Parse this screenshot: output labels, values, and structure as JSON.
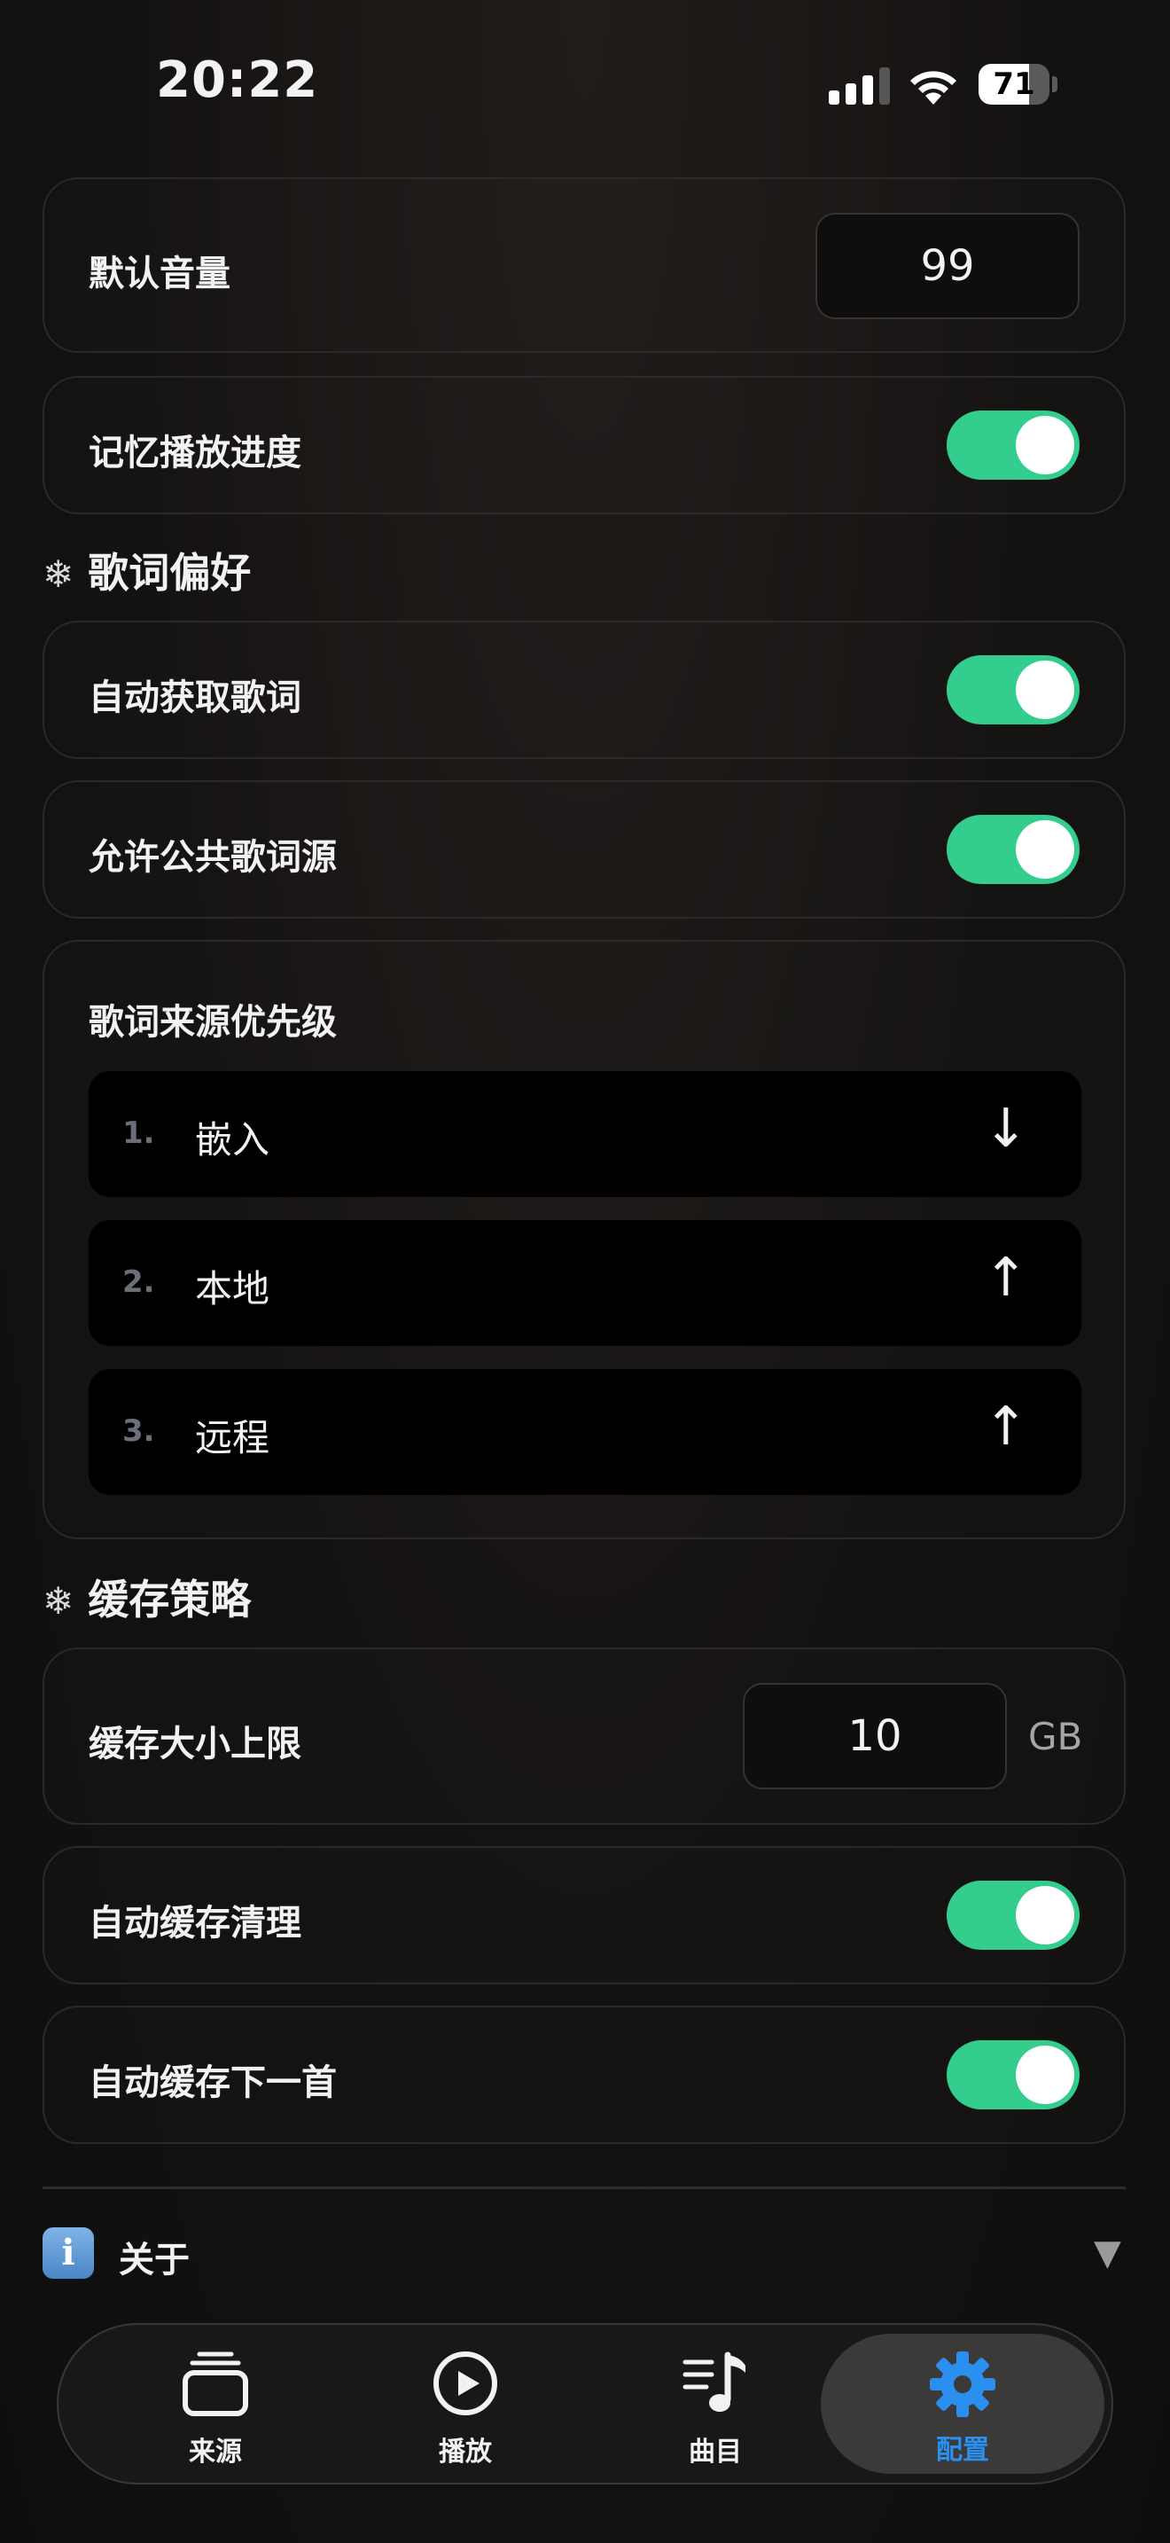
{
  "status_bar": {
    "time": "20:22",
    "battery": "71",
    "battery_level": 0.71
  },
  "playback": {
    "default_volume_label": "默认音量",
    "default_volume_value": "99",
    "remember_progress_label": "记忆播放进度",
    "remember_progress_on": true
  },
  "lyrics": {
    "section_title": "歌词偏好",
    "auto_fetch_label": "自动获取歌词",
    "auto_fetch_on": true,
    "public_source_label": "允许公共歌词源",
    "public_source_on": true,
    "priority_title": "歌词来源优先级",
    "priority": [
      {
        "num": "1.",
        "label": "嵌入",
        "arrow": "↓"
      },
      {
        "num": "2.",
        "label": "本地",
        "arrow": "↑"
      },
      {
        "num": "3.",
        "label": "远程",
        "arrow": "↑"
      }
    ]
  },
  "cache": {
    "section_title": "缓存策略",
    "size_limit_label": "缓存大小上限",
    "size_limit_value": "10",
    "size_unit": "GB",
    "auto_clean_label": "自动缓存清理",
    "auto_clean_on": true,
    "auto_next_label": "自动缓存下一首",
    "auto_next_on": true
  },
  "about": {
    "label": "关于",
    "icon_text": "i",
    "chevron": "▼"
  },
  "tabbar": {
    "items": [
      {
        "label": "来源",
        "icon": "stack-icon"
      },
      {
        "label": "播放",
        "icon": "play-circle-icon"
      },
      {
        "label": "曲目",
        "icon": "music-list-icon"
      },
      {
        "label": "配置",
        "icon": "gear-icon"
      }
    ],
    "active": "配置"
  },
  "colors": {
    "toggle_on": "#33cd8e",
    "accent": "#2b8ff0",
    "background": "#141211"
  },
  "section_icon": "❄"
}
